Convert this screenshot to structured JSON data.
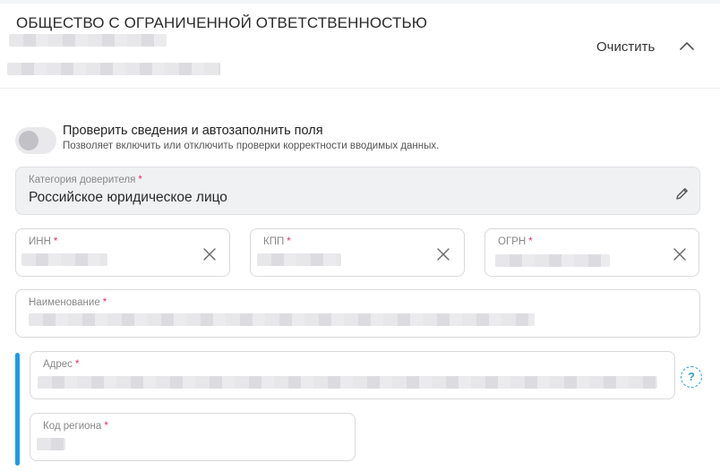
{
  "header": {
    "title": "ОБЩЕСТВО С ОГРАНИЧЕННОЙ ОТВЕТСТВЕННОСТЬЮ",
    "clear_label": "Очистить"
  },
  "autofill": {
    "enabled": false,
    "title": "Проверить сведения и автозаполнить поля",
    "description": "Позволяет включить или отключить проверки корректности вводимых данных."
  },
  "fields": {
    "category": {
      "label": "Категория доверителя",
      "value": "Российское юридическое лицо"
    },
    "inn": {
      "label": "ИНН"
    },
    "kpp": {
      "label": "КПП"
    },
    "ogrn": {
      "label": "ОГРН"
    },
    "name": {
      "label": "Наименование"
    },
    "address": {
      "label": "Адрес",
      "help": "?"
    },
    "region_code": {
      "label": "Код региона"
    }
  },
  "required_marker": "*",
  "colors": {
    "accent": "#1e9be8",
    "required": "#e0306e",
    "help": "#2aa7c9"
  }
}
